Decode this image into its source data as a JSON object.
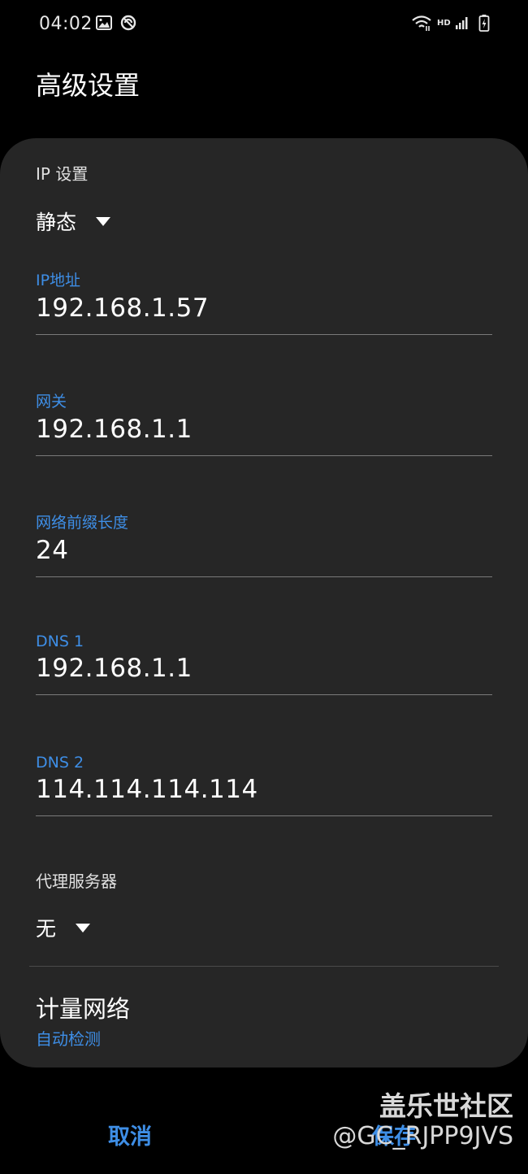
{
  "status_bar": {
    "time": "04:02",
    "left_icons": [
      "image-icon",
      "sync-icon"
    ],
    "right_icons": [
      "wifi-icon",
      "hd-icon",
      "signal-icon",
      "battery-icon"
    ],
    "hd_label": "HD"
  },
  "header": {
    "title": "高级设置"
  },
  "ip_settings": {
    "label": "IP 设置",
    "selected": "静态"
  },
  "fields": {
    "ip_address": {
      "label": "IP地址",
      "value": "192.168.1.57"
    },
    "gateway": {
      "label": "网关",
      "value": "192.168.1.1"
    },
    "prefix_length": {
      "label": "网络前缀长度",
      "value": "24"
    },
    "dns1": {
      "label": "DNS 1",
      "value": "192.168.1.1"
    },
    "dns2": {
      "label": "DNS 2",
      "value": "114.114.114.114"
    }
  },
  "proxy": {
    "label": "代理服务器",
    "selected": "无"
  },
  "metered": {
    "title": "计量网络",
    "value": "自动检测"
  },
  "actions": {
    "cancel": "取消",
    "save": "保存"
  },
  "watermark": {
    "line1": "盖乐世社区",
    "line2": "@GC_RJPP9JVS"
  },
  "colors": {
    "accent": "#3e8ee6",
    "card_bg": "#262626",
    "background": "#000000"
  }
}
